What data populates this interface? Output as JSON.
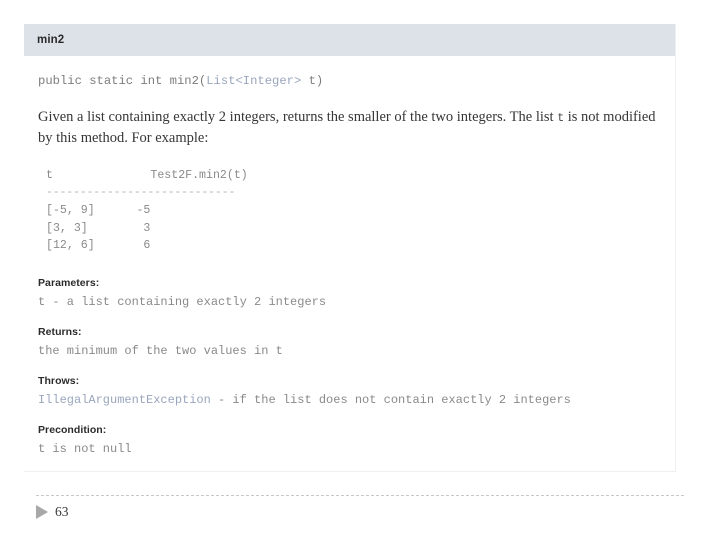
{
  "slide": {
    "page_number": "63",
    "nav_icon": "play-triangle-icon",
    "background_color": "#ffffff"
  },
  "javadoc": {
    "header": {
      "method_name": "min2",
      "bar_color": "#dde1e8"
    },
    "signature": {
      "prefix": "public static int min2(",
      "type_link": "List<Integer>",
      "suffix": " t)",
      "link_color": "#9aa6bd"
    },
    "description": {
      "part1": "Given a list containing exactly 2 integers, returns the smaller of the two integers. The list ",
      "code": "t",
      "part2": " is not modified by this method. For example:"
    },
    "example_table": {
      "header": "t              Test2F.min2(t)",
      "separator": "----------------------------",
      "rows": [
        "[-5, 9]      -5",
        "[3, 3]        3",
        "[12, 6]       6"
      ]
    },
    "sections": [
      {
        "label": "Parameters:",
        "value": "t - a list containing exactly 2 integers"
      },
      {
        "label": "Returns:",
        "value": "the minimum of the two values in t"
      },
      {
        "label": "Throws:",
        "exception": "IllegalArgumentException",
        "value": " - if the list does not contain exactly 2 integers"
      },
      {
        "label": "Precondition:",
        "value": "t is not null"
      }
    ]
  }
}
